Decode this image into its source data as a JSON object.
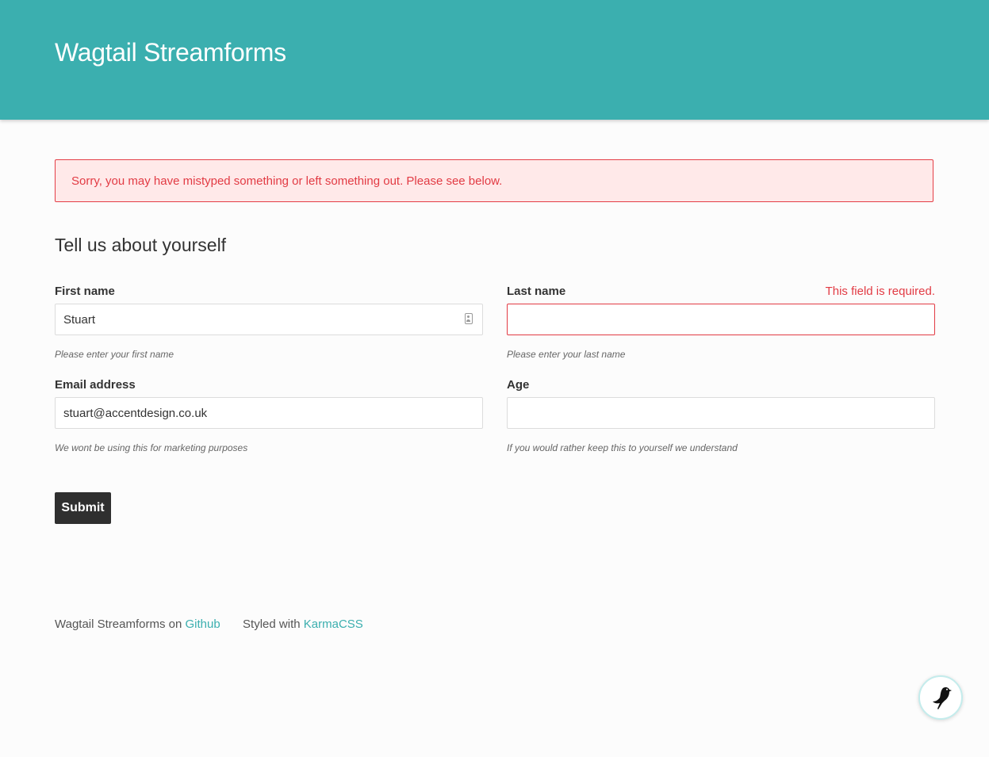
{
  "header": {
    "title": "Wagtail Streamforms"
  },
  "alert": {
    "message": "Sorry, you may have mistyped something or left something out. Please see below."
  },
  "form": {
    "heading": "Tell us about yourself",
    "fields": {
      "first_name": {
        "label": "First name",
        "value": "Stuart",
        "placeholder": "",
        "help": "Please enter your first name"
      },
      "last_name": {
        "label": "Last name",
        "value": "",
        "placeholder": "",
        "help": "Please enter your last name",
        "error": "This field is required."
      },
      "email": {
        "label": "Email address",
        "value": "stuart@accentdesign.co.uk",
        "placeholder": "",
        "help": "We wont be using this for marketing purposes"
      },
      "age": {
        "label": "Age",
        "value": "",
        "placeholder": "",
        "help": "If you would rather keep this to yourself we understand"
      }
    },
    "submit_label": "Submit"
  },
  "footer": {
    "github_prefix": "Wagtail Streamforms on",
    "github_link": "Github",
    "styled_prefix": "Styled with",
    "styled_link": "KarmaCSS"
  },
  "colors": {
    "header_bg": "#3bafaf",
    "error": "#e23b44",
    "alert_bg": "#ffe9e9",
    "link": "#3bafaf",
    "button_bg": "#2f2f2f"
  },
  "icons": {
    "first_name_field": "contact-card-icon",
    "userbar": "wagtail-bird-icon"
  }
}
